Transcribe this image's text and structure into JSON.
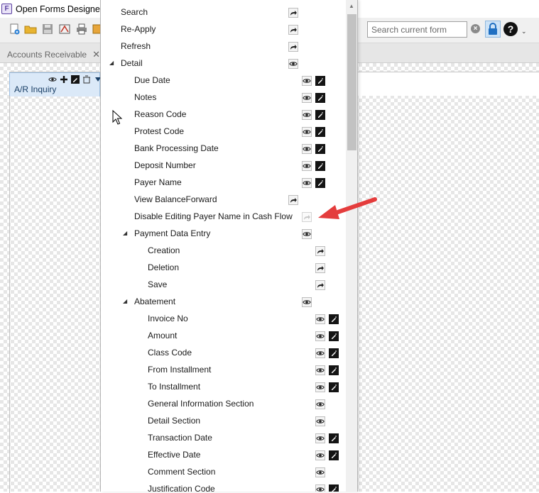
{
  "window": {
    "title": "Open Forms Designer",
    "app_icon_letter": "F"
  },
  "search": {
    "placeholder": "Search current form",
    "clear_symbol": "×"
  },
  "toolbar": {
    "help_symbol": "?",
    "more_symbol": "⌄"
  },
  "tabs": [
    {
      "label": "Accounts Receivable",
      "close_symbol": "✕"
    }
  ],
  "form": {
    "title": "A/R Inquiry"
  },
  "menu": {
    "items": [
      {
        "label": "Search"
      },
      {
        "label": "Re-Apply"
      },
      {
        "label": "Refresh"
      },
      {
        "label": "Detail"
      },
      {
        "label": "Due Date"
      },
      {
        "label": "Notes"
      },
      {
        "label": "Reason Code"
      },
      {
        "label": "Protest Code"
      },
      {
        "label": "Bank Processing Date"
      },
      {
        "label": "Deposit Number"
      },
      {
        "label": "Payer Name"
      },
      {
        "label": "View BalanceForward"
      },
      {
        "label": "Disable Editing Payer Name in Cash Flow"
      },
      {
        "label": "Payment Data Entry"
      },
      {
        "label": "Creation"
      },
      {
        "label": "Deletion"
      },
      {
        "label": "Save"
      },
      {
        "label": "Abatement"
      },
      {
        "label": "Invoice No"
      },
      {
        "label": "Amount"
      },
      {
        "label": "Class Code"
      },
      {
        "label": "From Installment"
      },
      {
        "label": "To Installment"
      },
      {
        "label": "General Information Section"
      },
      {
        "label": "Detail Section"
      },
      {
        "label": "Transaction Date"
      },
      {
        "label": "Effective Date"
      },
      {
        "label": "Comment Section"
      },
      {
        "label": "Justification Code"
      }
    ]
  }
}
